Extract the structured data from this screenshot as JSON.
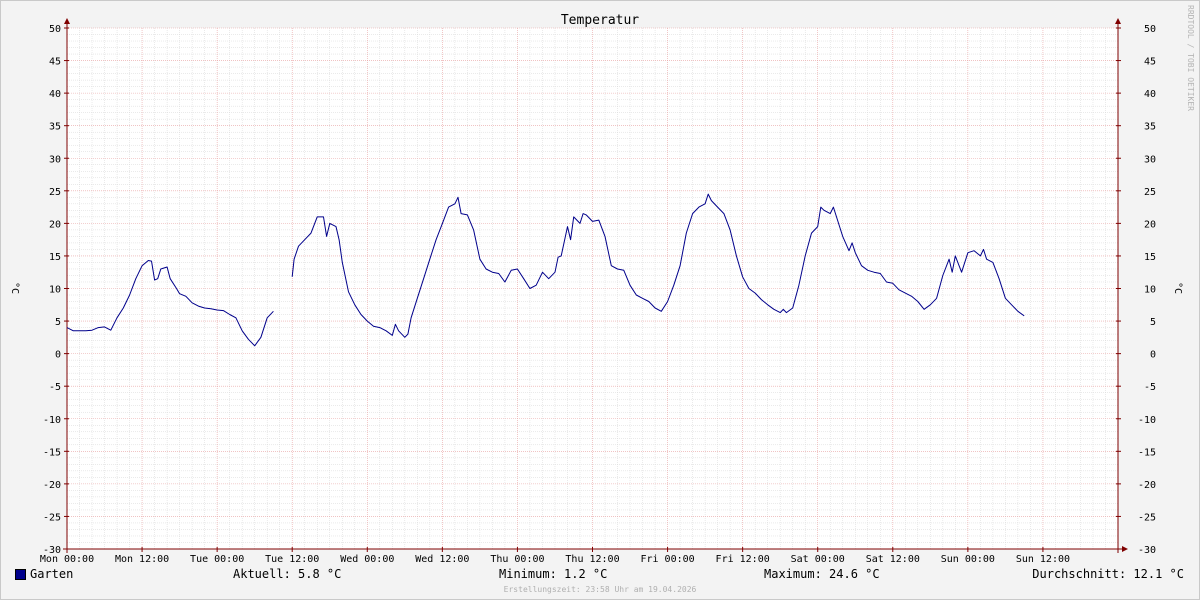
{
  "chart_data": {
    "type": "line",
    "title": "Temperatur",
    "ylabel": "°C",
    "ylim": [
      -30,
      50
    ],
    "yticks": [
      -30,
      -25,
      -20,
      -15,
      -10,
      -5,
      0,
      5,
      10,
      15,
      20,
      25,
      30,
      35,
      40,
      45,
      50
    ],
    "xlim_hours": [
      0,
      168
    ],
    "xticks": [
      {
        "hour": 0,
        "label": "Mon 00:00"
      },
      {
        "hour": 12,
        "label": "Mon 12:00"
      },
      {
        "hour": 24,
        "label": "Tue 00:00"
      },
      {
        "hour": 36,
        "label": "Tue 12:00"
      },
      {
        "hour": 48,
        "label": "Wed 00:00"
      },
      {
        "hour": 60,
        "label": "Wed 12:00"
      },
      {
        "hour": 72,
        "label": "Thu 00:00"
      },
      {
        "hour": 84,
        "label": "Thu 12:00"
      },
      {
        "hour": 96,
        "label": "Fri 00:00"
      },
      {
        "hour": 108,
        "label": "Fri 12:00"
      },
      {
        "hour": 120,
        "label": "Sat 00:00"
      },
      {
        "hour": 132,
        "label": "Sat 12:00"
      },
      {
        "hour": 144,
        "label": "Sun 00:00"
      },
      {
        "hour": 156,
        "label": "Sun 12:00"
      }
    ],
    "grid": true,
    "series": [
      {
        "name": "Garten",
        "color": "#00008b",
        "segments": [
          [
            [
              0,
              4.0
            ],
            [
              1,
              3.5
            ],
            [
              3,
              3.5
            ],
            [
              4,
              3.6
            ],
            [
              5,
              4.0
            ],
            [
              6,
              4.1
            ],
            [
              7,
              3.6
            ],
            [
              8,
              5.5
            ],
            [
              9,
              7.0
            ],
            [
              10,
              9.0
            ],
            [
              11,
              11.5
            ],
            [
              12,
              13.5
            ],
            [
              13,
              14.3
            ],
            [
              13.5,
              14.2
            ],
            [
              14,
              11.3
            ],
            [
              14.5,
              11.5
            ],
            [
              15,
              13.0
            ],
            [
              16,
              13.3
            ],
            [
              16.5,
              11.5
            ],
            [
              17.5,
              10.0
            ],
            [
              18,
              9.2
            ],
            [
              19,
              8.8
            ],
            [
              20,
              7.8
            ],
            [
              21,
              7.3
            ],
            [
              22,
              7.0
            ],
            [
              23,
              6.9
            ],
            [
              24,
              6.7
            ],
            [
              25,
              6.6
            ],
            [
              26,
              6.0
            ],
            [
              27,
              5.5
            ],
            [
              28,
              3.5
            ],
            [
              29,
              2.2
            ],
            [
              30,
              1.2
            ],
            [
              31,
              2.5
            ],
            [
              32,
              5.5
            ],
            [
              33,
              6.5
            ]
          ],
          [
            [
              36,
              11.8
            ],
            [
              36.3,
              14.5
            ],
            [
              37,
              16.5
            ],
            [
              38,
              17.5
            ],
            [
              39,
              18.5
            ],
            [
              40,
              21.0
            ],
            [
              41,
              21.0
            ],
            [
              41.5,
              18.0
            ],
            [
              42,
              20.0
            ],
            [
              43,
              19.5
            ],
            [
              43.5,
              17.5
            ],
            [
              44,
              14.0
            ],
            [
              45,
              9.5
            ],
            [
              46,
              7.5
            ],
            [
              47,
              6.0
            ],
            [
              48,
              5.0
            ],
            [
              49,
              4.2
            ],
            [
              50,
              4.0
            ],
            [
              51,
              3.5
            ],
            [
              52,
              2.8
            ],
            [
              52.5,
              4.5
            ],
            [
              53,
              3.5
            ],
            [
              54,
              2.5
            ],
            [
              54.5,
              3.0
            ],
            [
              55,
              5.5
            ],
            [
              56,
              8.5
            ],
            [
              57,
              11.5
            ],
            [
              58,
              14.5
            ],
            [
              59,
              17.5
            ],
            [
              60,
              20.0
            ],
            [
              61,
              22.5
            ],
            [
              62,
              23.0
            ],
            [
              62.5,
              24.0
            ],
            [
              63,
              21.5
            ],
            [
              64,
              21.3
            ],
            [
              65,
              19.0
            ],
            [
              66,
              14.5
            ],
            [
              67,
              13.0
            ],
            [
              68,
              12.5
            ],
            [
              69,
              12.3
            ],
            [
              70,
              11.0
            ],
            [
              71,
              12.8
            ],
            [
              72,
              13.0
            ],
            [
              73,
              11.5
            ],
            [
              74,
              10.0
            ],
            [
              75,
              10.5
            ],
            [
              76,
              12.5
            ],
            [
              77,
              11.5
            ],
            [
              78,
              12.5
            ],
            [
              78.5,
              14.8
            ],
            [
              79,
              15.0
            ],
            [
              80,
              19.5
            ],
            [
              80.5,
              17.5
            ],
            [
              81,
              21.0
            ],
            [
              82,
              20.0
            ],
            [
              82.5,
              21.5
            ],
            [
              83,
              21.3
            ],
            [
              84,
              20.3
            ],
            [
              85,
              20.5
            ],
            [
              86,
              18.0
            ],
            [
              87,
              13.5
            ],
            [
              88,
              13.0
            ],
            [
              89,
              12.8
            ],
            [
              90,
              10.5
            ],
            [
              91,
              9.0
            ],
            [
              92,
              8.5
            ],
            [
              93,
              8.0
            ],
            [
              94,
              7.0
            ],
            [
              95,
              6.5
            ],
            [
              96,
              8.0
            ],
            [
              97,
              10.5
            ],
            [
              98,
              13.5
            ],
            [
              99,
              18.5
            ],
            [
              100,
              21.5
            ],
            [
              101,
              22.5
            ],
            [
              102,
              23.0
            ],
            [
              102.5,
              24.5
            ],
            [
              103,
              23.5
            ],
            [
              104,
              22.5
            ],
            [
              105,
              21.5
            ],
            [
              106,
              19.0
            ],
            [
              107,
              15.0
            ],
            [
              108,
              11.8
            ],
            [
              109,
              10.0
            ],
            [
              110,
              9.3
            ],
            [
              111,
              8.3
            ],
            [
              112,
              7.5
            ],
            [
              113,
              6.8
            ],
            [
              114,
              6.3
            ],
            [
              114.5,
              6.8
            ],
            [
              115,
              6.3
            ],
            [
              116,
              7.0
            ],
            [
              117,
              10.5
            ],
            [
              118,
              15.0
            ],
            [
              119,
              18.5
            ],
            [
              120,
              19.5
            ],
            [
              120.5,
              22.5
            ],
            [
              121,
              22.0
            ],
            [
              122,
              21.5
            ],
            [
              122.5,
              22.5
            ],
            [
              123,
              21.0
            ],
            [
              124,
              18.0
            ],
            [
              125,
              15.8
            ],
            [
              125.5,
              17.0
            ],
            [
              126,
              15.5
            ],
            [
              127,
              13.5
            ],
            [
              128,
              12.8
            ],
            [
              129,
              12.5
            ],
            [
              130,
              12.3
            ],
            [
              131,
              11.0
            ],
            [
              132,
              10.8
            ],
            [
              133,
              9.8
            ],
            [
              134,
              9.3
            ],
            [
              135,
              8.8
            ],
            [
              136,
              8.0
            ],
            [
              137,
              6.8
            ],
            [
              138,
              7.5
            ],
            [
              139,
              8.5
            ],
            [
              140,
              12.0
            ],
            [
              141,
              14.5
            ],
            [
              141.5,
              12.5
            ],
            [
              142,
              15.0
            ],
            [
              143,
              12.5
            ],
            [
              144,
              15.5
            ],
            [
              145,
              15.8
            ],
            [
              146,
              15.0
            ],
            [
              146.5,
              16.0
            ],
            [
              147,
              14.5
            ],
            [
              148,
              14.0
            ],
            [
              149,
              11.5
            ],
            [
              150,
              8.5
            ],
            [
              151,
              7.5
            ],
            [
              152,
              6.5
            ],
            [
              153,
              5.8
            ]
          ]
        ]
      }
    ]
  },
  "legend": {
    "series_name": "Garten",
    "current": "Aktuell: 5.8 °C",
    "minimum": "Minimum: 1.2 °C",
    "maximum": "Maximum: 24.6 °C",
    "average": "Durchschnitt: 12.1 °C"
  },
  "footer": "Erstellungszeit: 23:58 Uhr am 19.04.2026",
  "watermark": "RRDTOOL / TOBI OETIKER",
  "colors": {
    "line": "#00008b",
    "major_grid": "#e8a0a0",
    "minor_grid": "#d6d6d6",
    "plot_bg": "#ffffff",
    "axis": "#7f0000"
  }
}
